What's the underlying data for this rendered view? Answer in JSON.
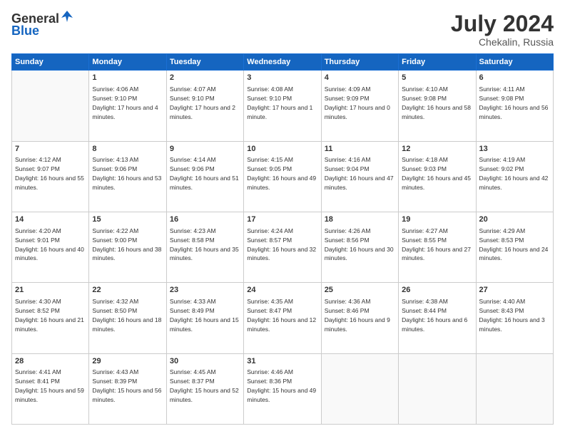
{
  "header": {
    "logo_general": "General",
    "logo_blue": "Blue",
    "title": "July 2024",
    "location": "Chekalin, Russia"
  },
  "weekdays": [
    "Sunday",
    "Monday",
    "Tuesday",
    "Wednesday",
    "Thursday",
    "Friday",
    "Saturday"
  ],
  "weeks": [
    [
      {
        "date": "",
        "sunrise": "",
        "sunset": "",
        "daylight": ""
      },
      {
        "date": "1",
        "sunrise": "Sunrise: 4:06 AM",
        "sunset": "Sunset: 9:10 PM",
        "daylight": "Daylight: 17 hours and 4 minutes."
      },
      {
        "date": "2",
        "sunrise": "Sunrise: 4:07 AM",
        "sunset": "Sunset: 9:10 PM",
        "daylight": "Daylight: 17 hours and 2 minutes."
      },
      {
        "date": "3",
        "sunrise": "Sunrise: 4:08 AM",
        "sunset": "Sunset: 9:10 PM",
        "daylight": "Daylight: 17 hours and 1 minute."
      },
      {
        "date": "4",
        "sunrise": "Sunrise: 4:09 AM",
        "sunset": "Sunset: 9:09 PM",
        "daylight": "Daylight: 17 hours and 0 minutes."
      },
      {
        "date": "5",
        "sunrise": "Sunrise: 4:10 AM",
        "sunset": "Sunset: 9:08 PM",
        "daylight": "Daylight: 16 hours and 58 minutes."
      },
      {
        "date": "6",
        "sunrise": "Sunrise: 4:11 AM",
        "sunset": "Sunset: 9:08 PM",
        "daylight": "Daylight: 16 hours and 56 minutes."
      }
    ],
    [
      {
        "date": "7",
        "sunrise": "Sunrise: 4:12 AM",
        "sunset": "Sunset: 9:07 PM",
        "daylight": "Daylight: 16 hours and 55 minutes."
      },
      {
        "date": "8",
        "sunrise": "Sunrise: 4:13 AM",
        "sunset": "Sunset: 9:06 PM",
        "daylight": "Daylight: 16 hours and 53 minutes."
      },
      {
        "date": "9",
        "sunrise": "Sunrise: 4:14 AM",
        "sunset": "Sunset: 9:06 PM",
        "daylight": "Daylight: 16 hours and 51 minutes."
      },
      {
        "date": "10",
        "sunrise": "Sunrise: 4:15 AM",
        "sunset": "Sunset: 9:05 PM",
        "daylight": "Daylight: 16 hours and 49 minutes."
      },
      {
        "date": "11",
        "sunrise": "Sunrise: 4:16 AM",
        "sunset": "Sunset: 9:04 PM",
        "daylight": "Daylight: 16 hours and 47 minutes."
      },
      {
        "date": "12",
        "sunrise": "Sunrise: 4:18 AM",
        "sunset": "Sunset: 9:03 PM",
        "daylight": "Daylight: 16 hours and 45 minutes."
      },
      {
        "date": "13",
        "sunrise": "Sunrise: 4:19 AM",
        "sunset": "Sunset: 9:02 PM",
        "daylight": "Daylight: 16 hours and 42 minutes."
      }
    ],
    [
      {
        "date": "14",
        "sunrise": "Sunrise: 4:20 AM",
        "sunset": "Sunset: 9:01 PM",
        "daylight": "Daylight: 16 hours and 40 minutes."
      },
      {
        "date": "15",
        "sunrise": "Sunrise: 4:22 AM",
        "sunset": "Sunset: 9:00 PM",
        "daylight": "Daylight: 16 hours and 38 minutes."
      },
      {
        "date": "16",
        "sunrise": "Sunrise: 4:23 AM",
        "sunset": "Sunset: 8:58 PM",
        "daylight": "Daylight: 16 hours and 35 minutes."
      },
      {
        "date": "17",
        "sunrise": "Sunrise: 4:24 AM",
        "sunset": "Sunset: 8:57 PM",
        "daylight": "Daylight: 16 hours and 32 minutes."
      },
      {
        "date": "18",
        "sunrise": "Sunrise: 4:26 AM",
        "sunset": "Sunset: 8:56 PM",
        "daylight": "Daylight: 16 hours and 30 minutes."
      },
      {
        "date": "19",
        "sunrise": "Sunrise: 4:27 AM",
        "sunset": "Sunset: 8:55 PM",
        "daylight": "Daylight: 16 hours and 27 minutes."
      },
      {
        "date": "20",
        "sunrise": "Sunrise: 4:29 AM",
        "sunset": "Sunset: 8:53 PM",
        "daylight": "Daylight: 16 hours and 24 minutes."
      }
    ],
    [
      {
        "date": "21",
        "sunrise": "Sunrise: 4:30 AM",
        "sunset": "Sunset: 8:52 PM",
        "daylight": "Daylight: 16 hours and 21 minutes."
      },
      {
        "date": "22",
        "sunrise": "Sunrise: 4:32 AM",
        "sunset": "Sunset: 8:50 PM",
        "daylight": "Daylight: 16 hours and 18 minutes."
      },
      {
        "date": "23",
        "sunrise": "Sunrise: 4:33 AM",
        "sunset": "Sunset: 8:49 PM",
        "daylight": "Daylight: 16 hours and 15 minutes."
      },
      {
        "date": "24",
        "sunrise": "Sunrise: 4:35 AM",
        "sunset": "Sunset: 8:47 PM",
        "daylight": "Daylight: 16 hours and 12 minutes."
      },
      {
        "date": "25",
        "sunrise": "Sunrise: 4:36 AM",
        "sunset": "Sunset: 8:46 PM",
        "daylight": "Daylight: 16 hours and 9 minutes."
      },
      {
        "date": "26",
        "sunrise": "Sunrise: 4:38 AM",
        "sunset": "Sunset: 8:44 PM",
        "daylight": "Daylight: 16 hours and 6 minutes."
      },
      {
        "date": "27",
        "sunrise": "Sunrise: 4:40 AM",
        "sunset": "Sunset: 8:43 PM",
        "daylight": "Daylight: 16 hours and 3 minutes."
      }
    ],
    [
      {
        "date": "28",
        "sunrise": "Sunrise: 4:41 AM",
        "sunset": "Sunset: 8:41 PM",
        "daylight": "Daylight: 15 hours and 59 minutes."
      },
      {
        "date": "29",
        "sunrise": "Sunrise: 4:43 AM",
        "sunset": "Sunset: 8:39 PM",
        "daylight": "Daylight: 15 hours and 56 minutes."
      },
      {
        "date": "30",
        "sunrise": "Sunrise: 4:45 AM",
        "sunset": "Sunset: 8:37 PM",
        "daylight": "Daylight: 15 hours and 52 minutes."
      },
      {
        "date": "31",
        "sunrise": "Sunrise: 4:46 AM",
        "sunset": "Sunset: 8:36 PM",
        "daylight": "Daylight: 15 hours and 49 minutes."
      },
      {
        "date": "",
        "sunrise": "",
        "sunset": "",
        "daylight": ""
      },
      {
        "date": "",
        "sunrise": "",
        "sunset": "",
        "daylight": ""
      },
      {
        "date": "",
        "sunrise": "",
        "sunset": "",
        "daylight": ""
      }
    ]
  ]
}
